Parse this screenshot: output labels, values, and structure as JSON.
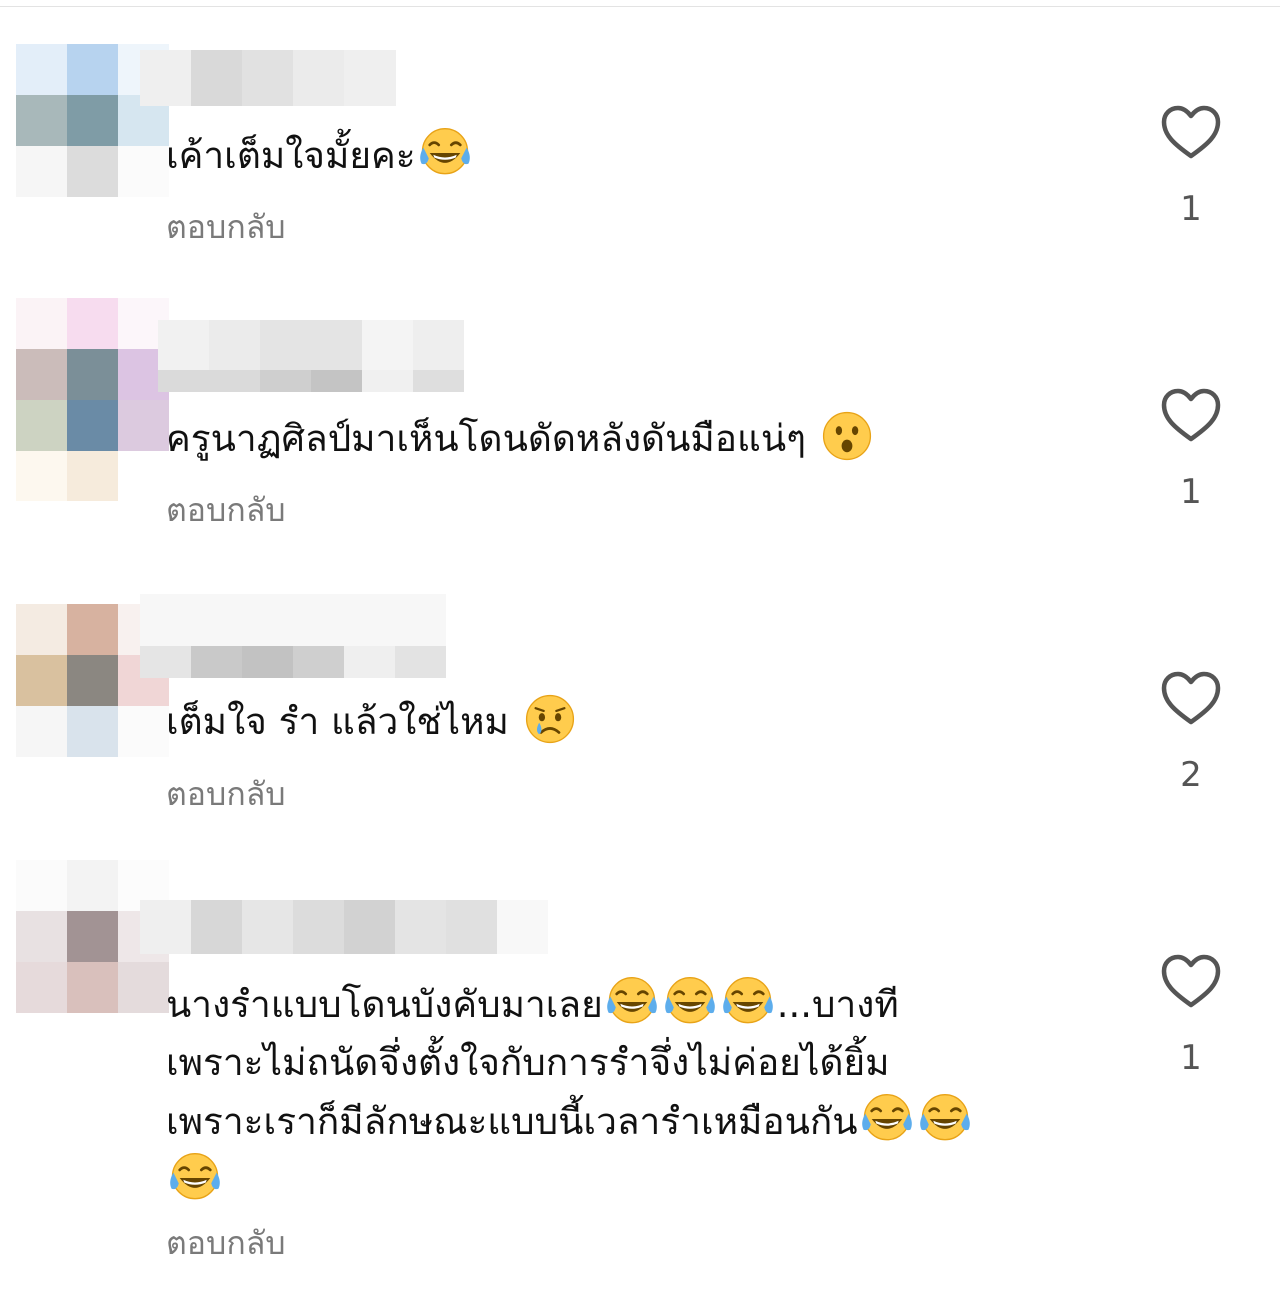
{
  "comments": [
    {
      "text": "เค้าเต็มใจมั้ยคะ",
      "emojis_after": [
        "tears-of-joy"
      ],
      "reply_label": "ตอบกลับ",
      "likes": "1"
    },
    {
      "text": "ครูนาฏศิลป์มาเห็นโดนดัดหลังดันมือแน่ๆ",
      "emojis_after": [
        "hushed-face"
      ],
      "reply_label": "ตอบกลับ",
      "likes": "1"
    },
    {
      "text": "เต็มใจ รำ แล้วใช่ไหม",
      "emojis_after": [
        "crying-face"
      ],
      "reply_label": "ตอบกลับ",
      "likes": "2"
    },
    {
      "line1": "นางรำแบบโดนบังคับมาเลย",
      "line1_tail": "...บางที",
      "line2": "เพราะไม่ถนัดจึ่งตั้งใจกับการรำจึ่งไม่ค่อยได้ยิ้ม",
      "line3": "เพราะเราก็มีลักษณะแบบนี้เวลารำเหมือนกัน",
      "reply_label": "ตอบกลับ",
      "likes": "1"
    }
  ],
  "icons": {
    "like": "heart-outline-icon",
    "emoji_laugh": "tears-of-joy-emoji",
    "emoji_surprise": "hushed-face-emoji",
    "emoji_sad": "crying-face-emoji"
  },
  "colors": {
    "reply": "#7a7a7a",
    "heart": "#555555",
    "text": "#111111"
  }
}
